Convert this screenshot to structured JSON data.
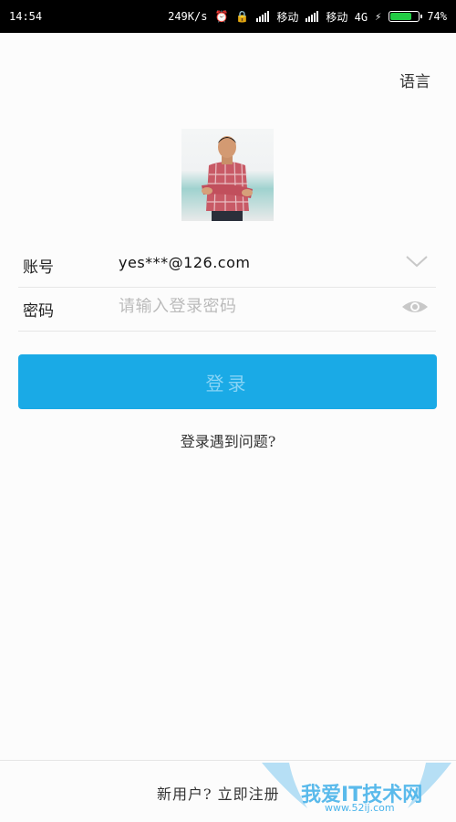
{
  "status_bar": {
    "time": "14:54",
    "speed": "249K/s",
    "carrier1": "移动",
    "carrier2": "移动 4G",
    "battery": "74%",
    "battery_level": 0.74
  },
  "header": {
    "language_label": "语言"
  },
  "form": {
    "account_label": "账号",
    "account_value": "yes***@126.com",
    "password_label": "密码",
    "password_placeholder": "请输入登录密码"
  },
  "login_button": "登录",
  "trouble_link": "登录遇到问题?",
  "register_link": "新用户? 立即注册",
  "watermark": {
    "text": "我爱IT技术网",
    "sub": "www.52ij.com"
  },
  "colors": {
    "primary": "#1aaae6",
    "button_text": "#88d4f5",
    "battery": "#22cc44"
  }
}
